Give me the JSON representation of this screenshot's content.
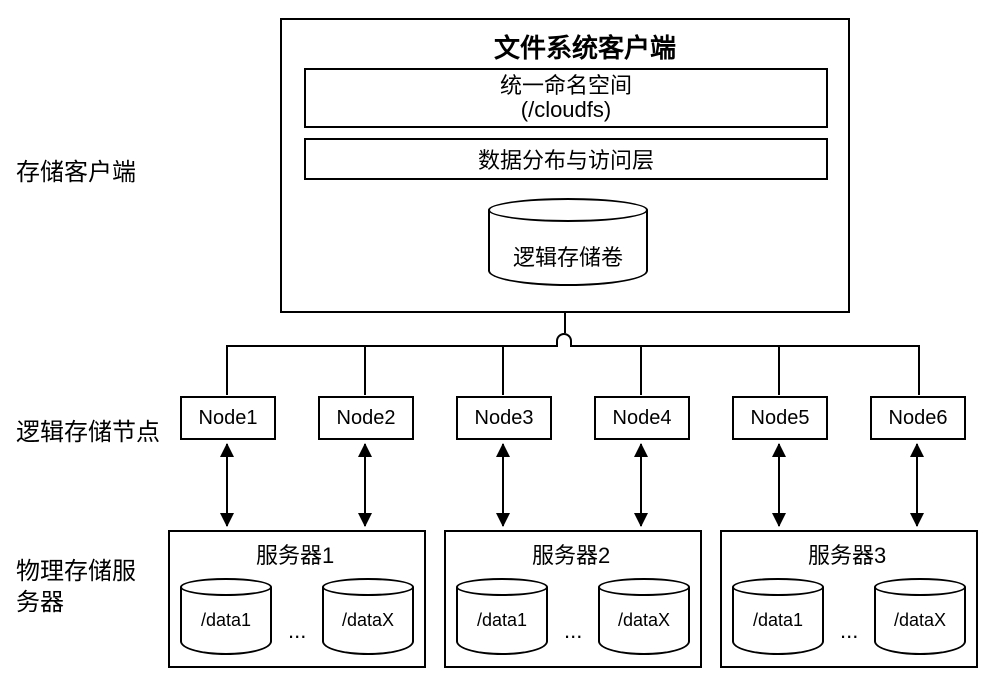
{
  "labels": {
    "storageClient": "存储客户端",
    "logicalNode": "逻辑存储节点",
    "physicalServer": "物理存储服务器"
  },
  "client": {
    "title": "文件系统客户端",
    "namespaceTop": "统一命名空间",
    "namespaceBottom": "(/cloudfs)",
    "dataLayer": "数据分布与访问层",
    "logicalVolume": "逻辑存储卷"
  },
  "nodes": [
    "Node1",
    "Node2",
    "Node3",
    "Node4",
    "Node5",
    "Node6"
  ],
  "servers": [
    {
      "title": "服务器1",
      "disks": [
        "/data1",
        "...",
        "/dataX"
      ]
    },
    {
      "title": "服务器2",
      "disks": [
        "/data1",
        "...",
        "/dataX"
      ]
    },
    {
      "title": "服务器3",
      "disks": [
        "/data1",
        "...",
        "/dataX"
      ]
    }
  ]
}
